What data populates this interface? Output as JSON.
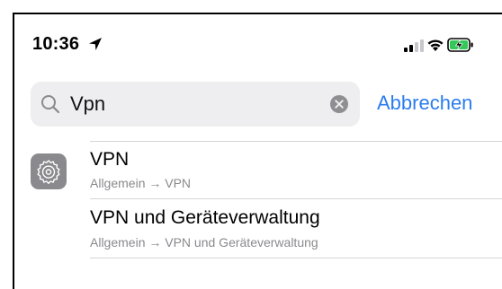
{
  "status_bar": {
    "time": "10:36",
    "icons": [
      "location-arrow-icon",
      "cellular-signal-icon",
      "wifi-icon",
      "battery-charging-icon"
    ]
  },
  "search": {
    "query": "Vpn",
    "cancel_label": "Abbrechen"
  },
  "results": [
    {
      "title": "VPN",
      "path": "Allgemein → VPN",
      "icon": "settings-gear-icon"
    },
    {
      "title": "VPN und Geräteverwaltung",
      "path": "Allgemein → VPN und Geräteverwaltung"
    }
  ],
  "colors": {
    "accent": "#2b7cf0",
    "search_bg": "#eeeef0",
    "secondary_text": "#8a8a8e",
    "battery_charging": "#34c759"
  }
}
